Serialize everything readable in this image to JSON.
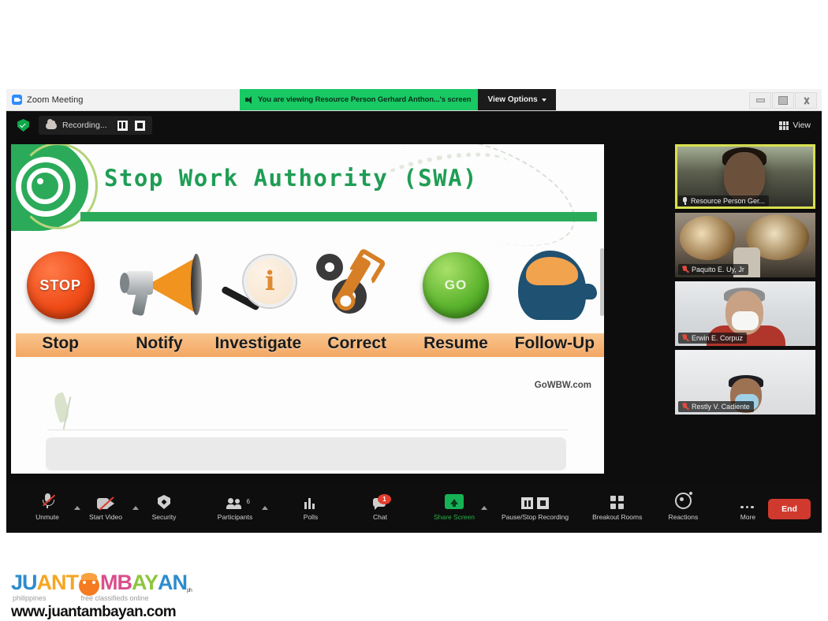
{
  "window": {
    "titlebar": {
      "app_title": "Zoom Meeting",
      "share_banner": "You are viewing Resource Person Gerhard Anthon...'s screen",
      "view_options_label": "View Options",
      "minimize_icon": "minimize-icon",
      "maximize_icon": "maximize-icon",
      "close_icon": "close-icon"
    },
    "recording_bar": {
      "status_text": "Recording...",
      "pause_icon": "pause-icon",
      "stop_icon": "stop-icon",
      "shield_icon": "encryption-shield-icon",
      "cloud_icon": "cloud-recording-icon",
      "view_label": "View",
      "view_icon": "grid-view-icon"
    }
  },
  "shared_screen": {
    "slide_title": "Stop Work Authority (SWA)",
    "watermark": "GoWBW.com",
    "logo_icon": "bullseye-target-icon",
    "steps": [
      {
        "label": "Stop",
        "icon": "stop-button-icon",
        "icon_text": "STOP"
      },
      {
        "label": "Notify",
        "icon": "megaphone-icon",
        "icon_text": ""
      },
      {
        "label": "Investigate",
        "icon": "magnifier-info-icon",
        "icon_text": "i"
      },
      {
        "label": "Correct",
        "icon": "gears-wrench-icon",
        "icon_text": ""
      },
      {
        "label": "Resume",
        "icon": "go-button-icon",
        "icon_text": "GO"
      },
      {
        "label": "Follow-Up",
        "icon": "head-brain-icon",
        "icon_text": ""
      }
    ]
  },
  "participants": [
    {
      "name": "Resource Person Ger...",
      "mic": "mic-on-icon",
      "active_speaker": true
    },
    {
      "name": "Paquito E. Uy, Jr",
      "mic": "mic-off-icon",
      "active_speaker": false
    },
    {
      "name": "Erwin E. Corpuz",
      "mic": "mic-off-icon",
      "active_speaker": false
    },
    {
      "name": "Restly V. Cadiente",
      "mic": "mic-off-icon",
      "active_speaker": false
    }
  ],
  "toolbar": {
    "unmute_label": "Unmute",
    "start_video_label": "Start Video",
    "security_label": "Security",
    "participants_label": "Participants",
    "participants_count": "6",
    "polls_label": "Polls",
    "chat_label": "Chat",
    "chat_badge": "1",
    "share_screen_label": "Share Screen",
    "recording_label": "Pause/Stop Recording",
    "breakout_label": "Breakout Rooms",
    "reactions_label": "Reactions",
    "more_label": "More",
    "end_label": "End"
  },
  "footer": {
    "brand_part1": "JU",
    "brand_part2": "ANT",
    "brand_part3": "MB",
    "brand_part4": "AY",
    "brand_part5": "AN",
    "brand_tm": "ph",
    "tag_left": "philippines",
    "tag_right": "free classifieds online",
    "url": "www.juantambayan.com"
  },
  "colors": {
    "share_green": "#18c964",
    "accent_orange": "#f3a763",
    "end_red": "#d03a2e",
    "active_speaker": "#d9e04f"
  }
}
